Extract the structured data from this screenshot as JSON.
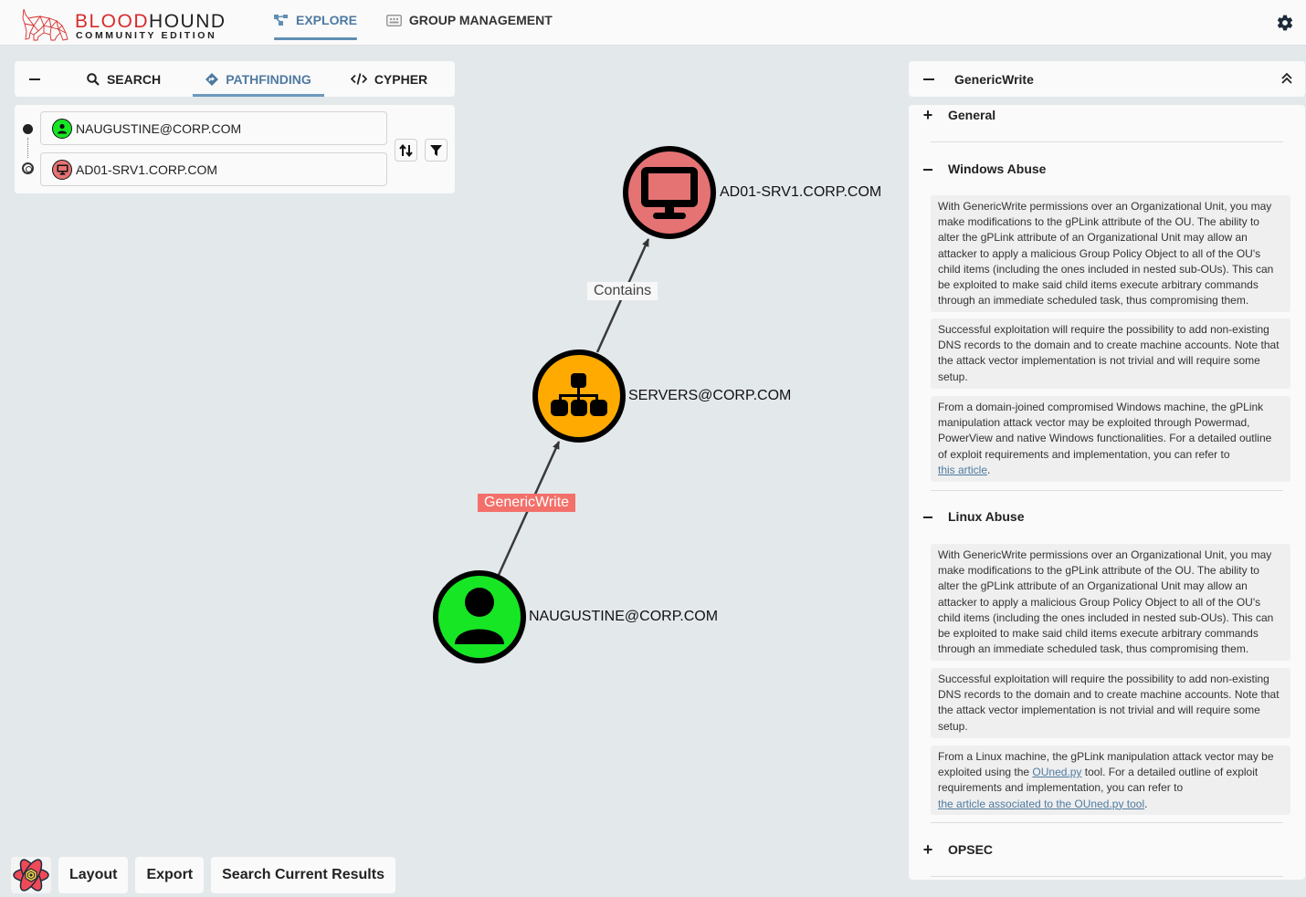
{
  "app": {
    "logo_title_red": "BLOOD",
    "logo_title_rest": "HOUND",
    "logo_subtitle": "COMMUNITY EDITION"
  },
  "nav": {
    "items": [
      {
        "label": "EXPLORE",
        "icon": "explore-graph-icon",
        "active": true
      },
      {
        "label": "GROUP MANAGEMENT",
        "icon": "group-management-icon",
        "active": false
      }
    ],
    "settings_icon": "gear-icon"
  },
  "search_panel": {
    "tabs": [
      {
        "label": "SEARCH",
        "icon": "search-icon",
        "active": false
      },
      {
        "label": "PATHFINDING",
        "icon": "pathfinding-icon",
        "active": true
      },
      {
        "label": "CYPHER",
        "icon": "code-icon",
        "active": false
      }
    ],
    "start_node": {
      "value": "NAUGUSTINE@CORP.COM",
      "type": "user"
    },
    "end_node": {
      "value": "AD01-SRV1.CORP.COM",
      "type": "computer"
    },
    "swap_icon": "swap-vertical-icon",
    "filter_icon": "filter-icon"
  },
  "graph": {
    "nodes": [
      {
        "label": "AD01-SRV1.CORP.COM",
        "type": "computer",
        "color": "#e57373"
      },
      {
        "label": "SERVERS@CORP.COM",
        "type": "ou",
        "color": "#ffaa00"
      },
      {
        "label": "NAUGUSTINE@CORP.COM",
        "type": "user",
        "color": "#17e625"
      }
    ],
    "edges": [
      {
        "label": "Contains",
        "from": "SERVERS@CORP.COM",
        "to": "AD01-SRV1.CORP.COM"
      },
      {
        "label": "GenericWrite",
        "from": "NAUGUSTINE@CORP.COM",
        "to": "SERVERS@CORP.COM",
        "highlighted": true
      }
    ]
  },
  "bottom_bar": {
    "layout": "Layout",
    "export": "Export",
    "search_results": "Search Current Results"
  },
  "edge_panel": {
    "title": "GenericWrite",
    "sections": [
      {
        "label": "General",
        "expanded": false
      },
      {
        "label": "Windows Abuse",
        "expanded": true,
        "paragraphs": [
          "With GenericWrite permissions over an Organizational Unit, you may make modifications to the gPLink attribute of the OU. The ability to alter the gPLink attribute of an Organizational Unit may allow an attacker to apply a malicious Group Policy Object to all of the OU's child items (including the ones included in nested sub-OUs). This can be exploited to make said child items execute arbitrary commands through an immediate scheduled task, thus compromising them.",
          "Successful exploitation will require the possibility to add non-existing DNS records to the domain and to create machine accounts. Note that the attack vector implementation is not trivial and will require some setup.",
          "From a domain-joined compromised Windows machine, the gPLink manipulation attack vector may be exploited through Powermad, PowerView and native Windows functionalities. For a detailed outline of exploit requirements and implementation, you can refer to "
        ],
        "link_text": "this article",
        "link_suffix": "."
      },
      {
        "label": "Linux Abuse",
        "expanded": true,
        "paragraphs": [
          "With GenericWrite permissions over an Organizational Unit, you may make modifications to the gPLink attribute of the OU. The ability to alter the gPLink attribute of an Organizational Unit may allow an attacker to apply a malicious Group Policy Object to all of the OU's child items (including the ones included in nested sub-OUs). This can be exploited to make said child items execute arbitrary commands through an immediate scheduled task, thus compromising them.",
          "Successful exploitation will require the possibility to add non-existing DNS records to the domain and to create machine accounts. Note that the attack vector implementation is not trivial and will require some setup."
        ],
        "linux_p3_a": "From a Linux machine, the gPLink manipulation attack vector may be exploited using the ",
        "linux_p3_link1": "OUned.py",
        "linux_p3_b": " tool. For a detailed outline of exploit requirements and implementation, you can refer to ",
        "linux_p3_link2": "the article associated to the OUned.py tool",
        "linux_p3_c": "."
      },
      {
        "label": "OPSEC",
        "expanded": false
      }
    ]
  }
}
